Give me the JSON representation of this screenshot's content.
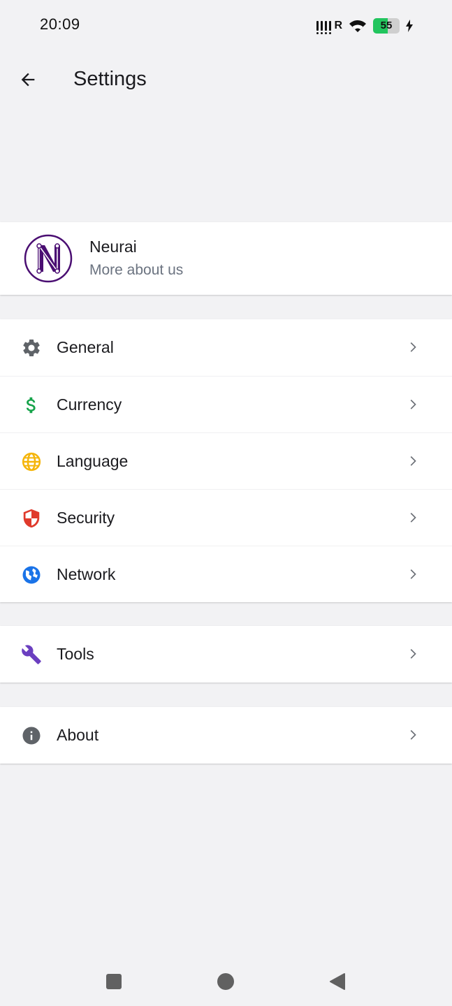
{
  "status_bar": {
    "time": "20:09",
    "signal_label": "R",
    "battery_level": "55",
    "battery_fraction": 0.55,
    "battery_color": "#22c55e"
  },
  "app_bar": {
    "title": "Settings",
    "back_icon": "arrow-back-icon"
  },
  "profile": {
    "name": "Neurai",
    "subtitle": "More about us",
    "logo_color": "#4a0e72"
  },
  "menu": {
    "main": [
      {
        "label": "General",
        "icon": "gear-icon",
        "color": "#5f6368"
      },
      {
        "label": "Currency",
        "icon": "dollar-icon",
        "color": "#16a34a"
      },
      {
        "label": "Language",
        "icon": "globe-icon",
        "color": "#f5b50a"
      },
      {
        "label": "Security",
        "icon": "shield-icon",
        "color": "#e03a2c"
      },
      {
        "label": "Network",
        "icon": "network-globe-icon",
        "color": "#1a73e8"
      }
    ],
    "tools": {
      "label": "Tools",
      "icon": "wrench-icon",
      "color": "#6b3fc0"
    },
    "about": {
      "label": "About",
      "icon": "info-icon",
      "color": "#5f6368"
    }
  },
  "nav_bar": {
    "recents_icon": "square-icon",
    "home_icon": "circle-icon",
    "back_icon": "triangle-back-icon"
  }
}
